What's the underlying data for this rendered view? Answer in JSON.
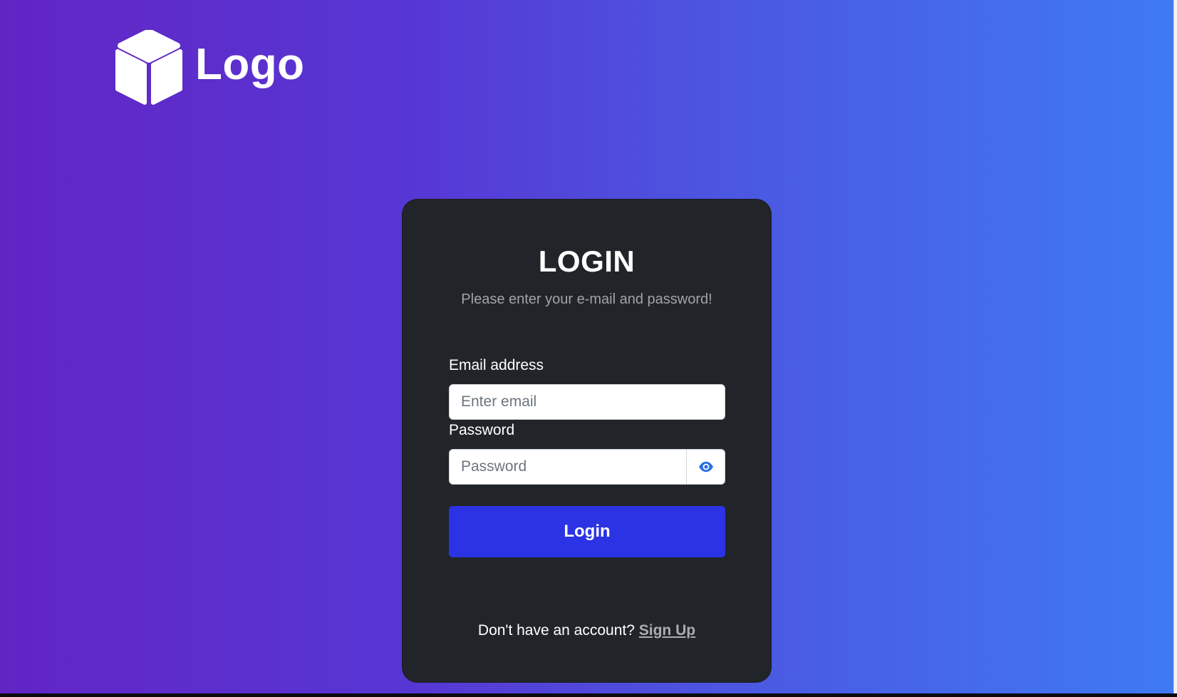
{
  "brand": {
    "name": "Logo",
    "icon": "cube-icon"
  },
  "card": {
    "title": "LOGIN",
    "subtitle": "Please enter your e-mail and password!"
  },
  "form": {
    "email_label": "Email address",
    "email_placeholder": "Enter email",
    "email_value": "",
    "password_label": "Password",
    "password_placeholder": "Password",
    "password_value": "",
    "toggle_icon": "eye-icon",
    "submit_label": "Login"
  },
  "footer": {
    "prompt": "Don't have an account?",
    "link_label": "Sign Up"
  },
  "colors": {
    "gradient_start": "#6125c4",
    "gradient_end": "#3f7af2",
    "card_bg": "#212529",
    "button_bg": "#2b33e5",
    "eye_icon": "#2b6fe6",
    "subtitle_text": "#a0a4a9",
    "link_text": "#a9acb2"
  }
}
